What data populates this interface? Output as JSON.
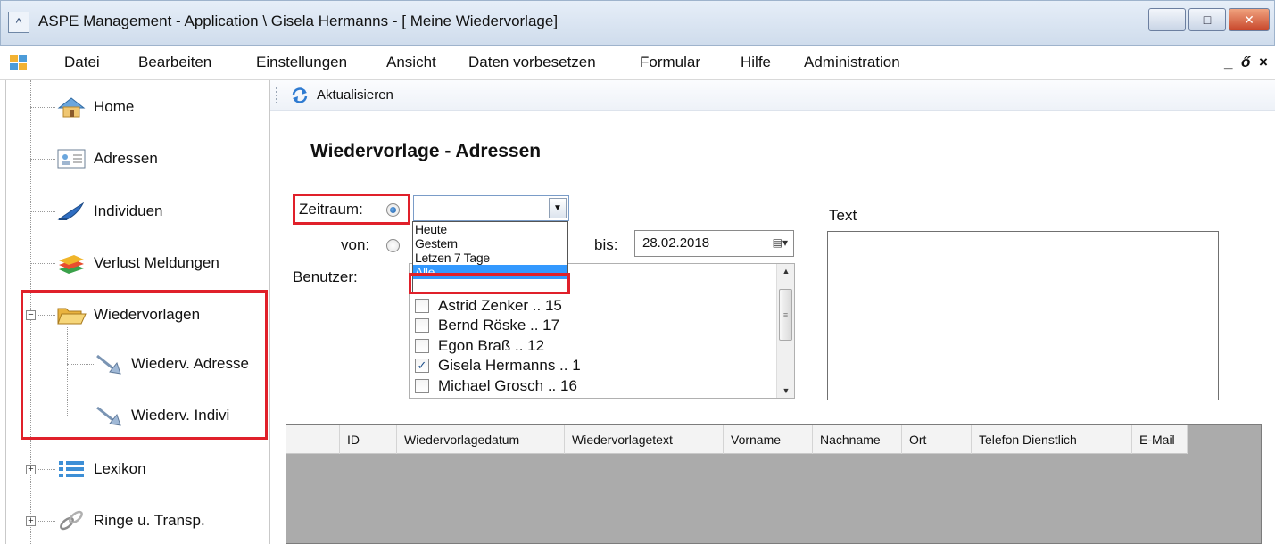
{
  "window": {
    "title": "ASPE Management - Application \\ Gisela Hermanns - [ Meine Wiedervorlage]",
    "icon": "window-menu-icon",
    "minimize_icon": "minimize-icon",
    "maximize_icon": "maximize-icon",
    "close_icon": "close-icon"
  },
  "menu": {
    "items": [
      "Datei",
      "Bearbeiten",
      "Einstellungen",
      "Ansicht",
      "Daten vorbesetzen",
      "Formular",
      "Hilfe",
      "Administration"
    ],
    "mdi_minimize": "_",
    "mdi_restore": "ő",
    "mdi_close": "×"
  },
  "tree": {
    "items": [
      {
        "label": "Home",
        "icon": "house-icon"
      },
      {
        "label": "Adressen",
        "icon": "address-card-icon"
      },
      {
        "label": "Individuen",
        "icon": "bird-icon"
      },
      {
        "label": "Verlust Meldungen",
        "icon": "books-icon"
      },
      {
        "label": "Wiedervorlagen",
        "icon": "open-folder-icon"
      },
      {
        "label": "Wiederv. Adresse",
        "icon": "arrow-doc-icon"
      },
      {
        "label": "Wiederv. Indivi",
        "icon": "arrow-doc-icon"
      },
      {
        "label": "Lexikon",
        "icon": "list-icon"
      },
      {
        "label": "Ringe u. Transp.",
        "icon": "chain-icon"
      }
    ],
    "highlight_color": "#e0202a"
  },
  "toolbar": {
    "refresh_label": "Aktualisieren"
  },
  "form": {
    "title": "Wiedervorlage - Adressen",
    "zeitraum_label": "Zeitraum:",
    "von_label": "von:",
    "bis_label": "bis:",
    "benutzer_label": "Benutzer:",
    "text_label": "Text",
    "combo_value": "",
    "dropdown_options": [
      "Heute",
      "Gestern",
      "Letzen 7 Tage",
      "Alle"
    ],
    "dropdown_selected": "Alle",
    "bis_date": "28.02.2018",
    "users": [
      {
        "label": "Astrid Zenker .. 15",
        "checked": false
      },
      {
        "label": "Bernd Röske .. 17",
        "checked": false
      },
      {
        "label": "Egon Braß .. 12",
        "checked": false
      },
      {
        "label": "Gisela Hermanns .. 1",
        "checked": true
      },
      {
        "label": "Michael Grosch .. 16",
        "checked": false
      }
    ]
  },
  "grid": {
    "columns": [
      "ID",
      "Wiedervorlagedatum",
      "Wiedervorlagetext",
      "Vorname",
      "Nachname",
      "Ort",
      "Telefon Dienstlich",
      "E-Mail"
    ]
  }
}
